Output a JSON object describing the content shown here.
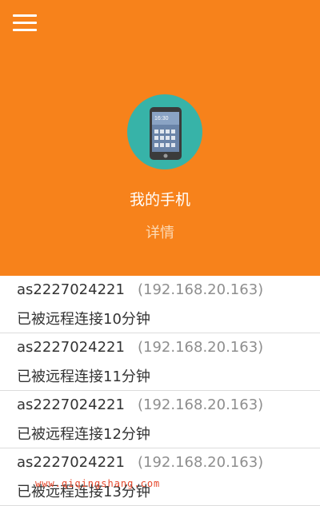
{
  "header": {
    "background_color": "#f7821b",
    "menu_icon": "hamburger-menu-icon",
    "device_icon": "smartphone-icon",
    "device_name": "我的手机",
    "details_label": "详情"
  },
  "connections": [
    {
      "host": "as2227024221",
      "ip": "(192.168.20.163)",
      "status": "已被远程连接10分钟"
    },
    {
      "host": "as2227024221",
      "ip": "(192.168.20.163)",
      "status": "已被远程连接11分钟"
    },
    {
      "host": "as2227024221",
      "ip": "(192.168.20.163)",
      "status": "已被远程连接12分钟"
    },
    {
      "host": "as2227024221",
      "ip": "(192.168.20.163)",
      "status": "已被远程连接13分钟"
    }
  ],
  "watermark": "www.qiqingshang.com"
}
